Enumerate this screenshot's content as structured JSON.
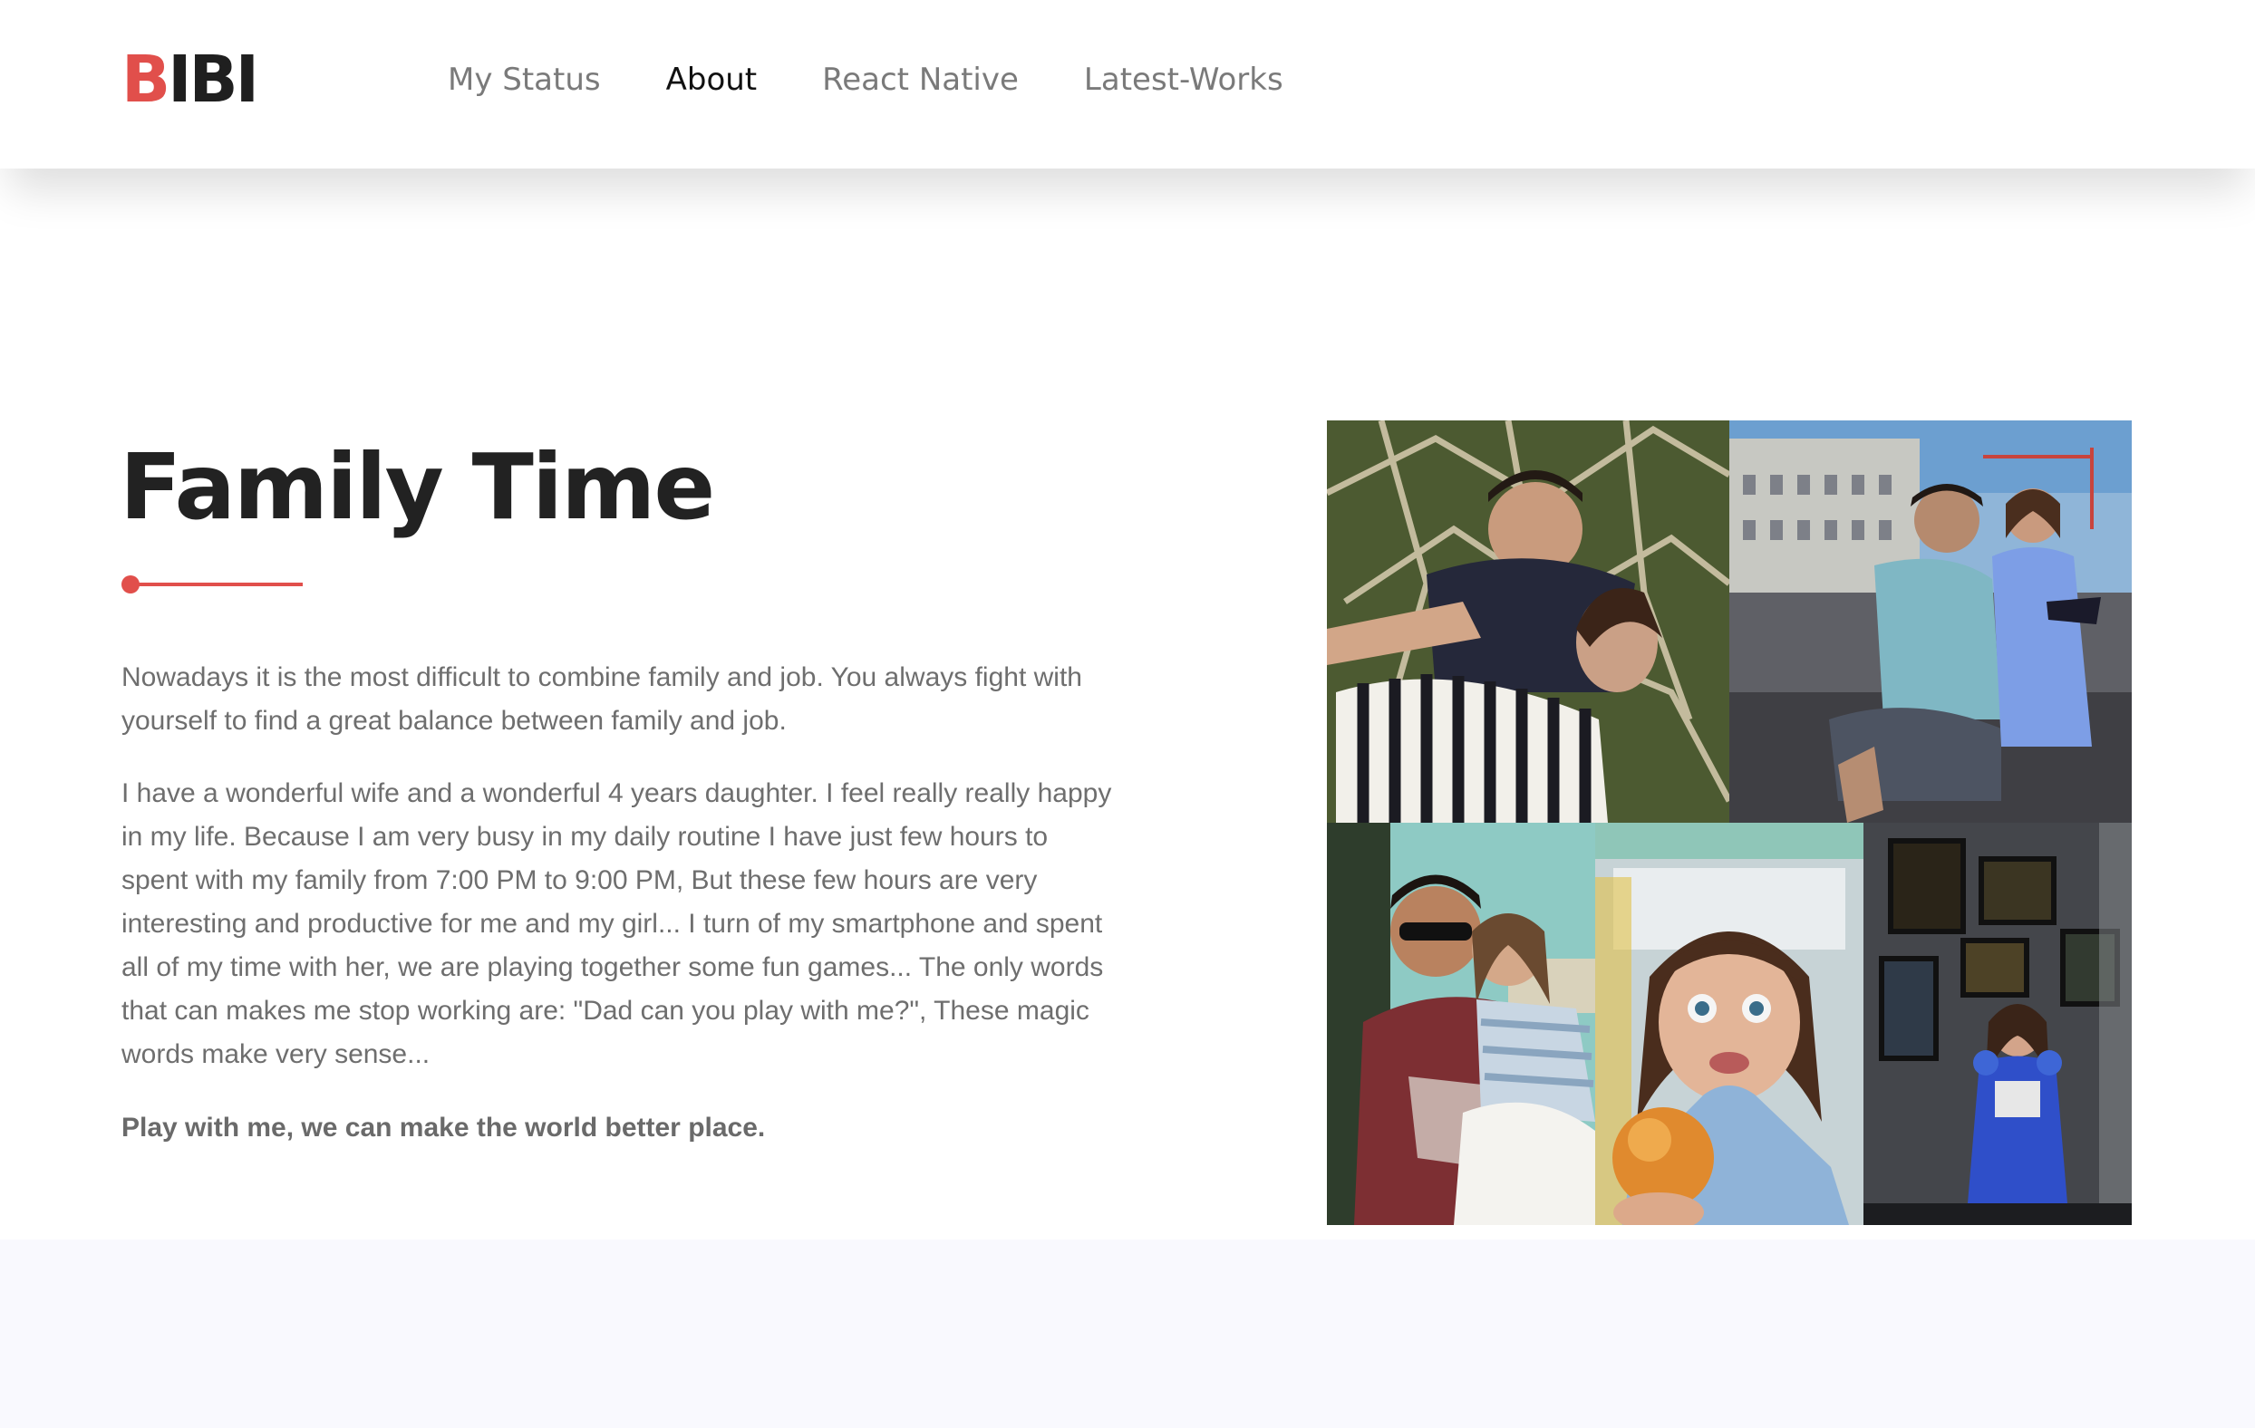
{
  "header": {
    "logo_first": "B",
    "logo_rest": "IBI",
    "nav": [
      "My Status",
      "About",
      "React Native",
      "Latest-Works"
    ],
    "active_nav": "About"
  },
  "about": {
    "title": "Family Time",
    "paragraph_1": "Nowadays it is the most difficult to combine family and job. You always fight with yourself to find a great balance between family and job.",
    "paragraph_2": "I have a wonderful wife and a wonderful 4 years daughter. I feel really really happy in my life. Because I am very busy in my daily routine I have just few hours to spent with my family from 7:00 PM to 9:00 PM, But these few hours are very interesting and productive for me and my girl... I turn of my smartphone and spent all of my time with her, we are playing together some fun games... The only words that can makes me stop working are: \"Dad can you play with me?\", These magic words make very sense...",
    "closing": "Play with me, we can make the world better place."
  },
  "colors": {
    "accent": "#e14f4b",
    "heading": "#222222",
    "body_text": "#6e6e6e",
    "nav_inactive": "#7a7a7a",
    "footer_band": "#f9f9fe"
  }
}
